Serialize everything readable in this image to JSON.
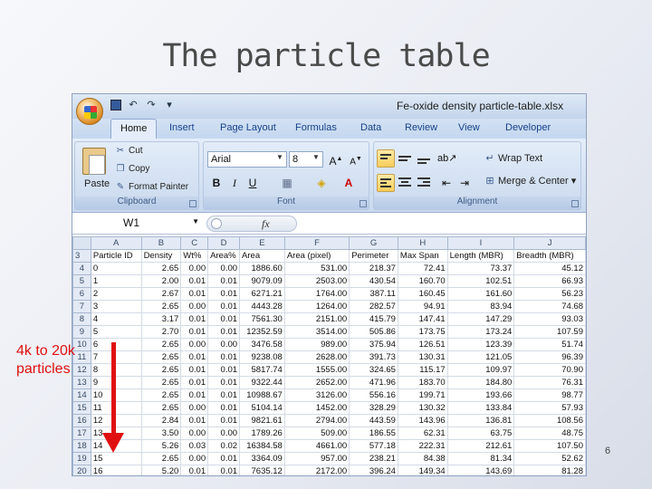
{
  "slide": {
    "title": "The particle table",
    "annotation": [
      "4k to 20k",
      "particles"
    ],
    "page_number": "6"
  },
  "excel": {
    "filename": "Fe-oxide density particle-table.xlsx",
    "tabs": [
      "Home",
      "Insert",
      "Page Layout",
      "Formulas",
      "Data",
      "Review",
      "View",
      "Developer"
    ],
    "active_tab": "Home",
    "clipboard": {
      "paste": "Paste",
      "cut": "Cut",
      "copy": "Copy",
      "format_painter": "Format Painter",
      "label": "Clipboard"
    },
    "font": {
      "name": "Arial",
      "size": "8",
      "label": "Font"
    },
    "alignment": {
      "wrap": "Wrap Text",
      "merge": "Merge & Center",
      "label": "Alignment"
    },
    "name_box": "W1",
    "fx": "fx",
    "columns": [
      "A",
      "B",
      "C",
      "D",
      "E",
      "F",
      "G",
      "H",
      "I",
      "J"
    ],
    "headers": [
      "Particle ID",
      "Density",
      "Wt%",
      "Area%",
      "Area",
      "Area (pixel)",
      "Perimeter",
      "Max Span",
      "Length (MBR)",
      "Breadth (MBR)"
    ],
    "header_row_number": "3",
    "rows": [
      {
        "r": "4",
        "cells": [
          "0",
          "2.65",
          "0.00",
          "0.00",
          "1886.60",
          "531.00",
          "218.37",
          "72.41",
          "73.37",
          "45.12"
        ]
      },
      {
        "r": "5",
        "cells": [
          "1",
          "2.00",
          "0.01",
          "0.01",
          "9079.09",
          "2503.00",
          "430.54",
          "160.70",
          "102.51",
          "66.93"
        ]
      },
      {
        "r": "6",
        "cells": [
          "2",
          "2.67",
          "0.01",
          "0.01",
          "6271.21",
          "1764.00",
          "387.11",
          "160.45",
          "161.60",
          "56.23"
        ]
      },
      {
        "r": "7",
        "cells": [
          "3",
          "2.65",
          "0.00",
          "0.01",
          "4443.28",
          "1264.00",
          "282.57",
          "94.91",
          "83.94",
          "74.68"
        ]
      },
      {
        "r": "8",
        "cells": [
          "4",
          "3.17",
          "0.01",
          "0.01",
          "7561.30",
          "2151.00",
          "415.79",
          "147.41",
          "147.29",
          "93.03"
        ]
      },
      {
        "r": "9",
        "cells": [
          "5",
          "2.70",
          "0.01",
          "0.01",
          "12352.59",
          "3514.00",
          "505.86",
          "173.75",
          "173.24",
          "107.59"
        ]
      },
      {
        "r": "10",
        "cells": [
          "6",
          "2.65",
          "0.00",
          "0.00",
          "3476.58",
          "989.00",
          "375.94",
          "126.51",
          "123.39",
          "51.74"
        ]
      },
      {
        "r": "11",
        "cells": [
          "7",
          "2.65",
          "0.01",
          "0.01",
          "9238.08",
          "2628.00",
          "391.73",
          "130.31",
          "121.05",
          "96.39"
        ]
      },
      {
        "r": "12",
        "cells": [
          "8",
          "2.65",
          "0.01",
          "0.01",
          "5817.74",
          "1555.00",
          "324.65",
          "115.17",
          "109.97",
          "70.90"
        ]
      },
      {
        "r": "13",
        "cells": [
          "9",
          "2.65",
          "0.01",
          "0.01",
          "9322.44",
          "2652.00",
          "471.96",
          "183.70",
          "184.80",
          "76.31"
        ]
      },
      {
        "r": "14",
        "cells": [
          "10",
          "2.65",
          "0.01",
          "0.01",
          "10988.67",
          "3126.00",
          "556.16",
          "199.71",
          "193.66",
          "98.77"
        ]
      },
      {
        "r": "15",
        "cells": [
          "11",
          "2.65",
          "0.00",
          "0.01",
          "5104.14",
          "1452.00",
          "328.29",
          "130.32",
          "133.84",
          "57.93"
        ]
      },
      {
        "r": "16",
        "cells": [
          "12",
          "2.84",
          "0.01",
          "0.01",
          "9821.61",
          "2794.00",
          "443.59",
          "143.96",
          "136.81",
          "108.56"
        ]
      },
      {
        "r": "17",
        "cells": [
          "13",
          "3.50",
          "0.00",
          "0.00",
          "1789.26",
          "509.00",
          "186.55",
          "62.31",
          "63.75",
          "48.75"
        ]
      },
      {
        "r": "18",
        "cells": [
          "14",
          "5.26",
          "0.03",
          "0.02",
          "16384.58",
          "4661.00",
          "577.18",
          "222.31",
          "212.61",
          "107.50"
        ]
      },
      {
        "r": "19",
        "cells": [
          "15",
          "2.65",
          "0.00",
          "0.01",
          "3364.09",
          "957.00",
          "238.21",
          "84.38",
          "81.34",
          "52.62"
        ]
      },
      {
        "r": "20",
        "cells": [
          "16",
          "5.20",
          "0.01",
          "0.01",
          "7635.12",
          "2172.00",
          "396.24",
          "149.34",
          "143.69",
          "81.28"
        ]
      }
    ]
  }
}
